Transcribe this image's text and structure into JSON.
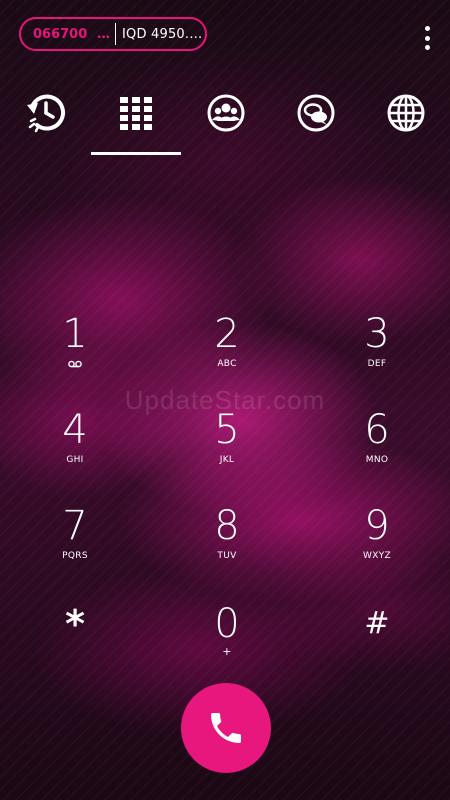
{
  "balance": {
    "number": "066700",
    "ellipsis": "…",
    "amount": "IQD 4950.…"
  },
  "tabs": [
    {
      "name": "recents"
    },
    {
      "name": "dialpad",
      "selected": true
    },
    {
      "name": "contacts"
    },
    {
      "name": "chats"
    },
    {
      "name": "web"
    }
  ],
  "keypad": [
    {
      "digit": "1",
      "letters": ""
    },
    {
      "digit": "2",
      "letters": "ABC"
    },
    {
      "digit": "3",
      "letters": "DEF"
    },
    {
      "digit": "4",
      "letters": "GHI"
    },
    {
      "digit": "5",
      "letters": "JKL"
    },
    {
      "digit": "6",
      "letters": "MNO"
    },
    {
      "digit": "7",
      "letters": "PQRS"
    },
    {
      "digit": "8",
      "letters": "TUV"
    },
    {
      "digit": "9",
      "letters": "WXYZ"
    },
    {
      "digit": "*",
      "letters": ""
    },
    {
      "digit": "0",
      "letters": "+"
    },
    {
      "digit": "#",
      "letters": ""
    }
  ],
  "watermark": "UpdateStar.com",
  "colors": {
    "accent": "#e6157a",
    "call_button": "#e8177d"
  }
}
